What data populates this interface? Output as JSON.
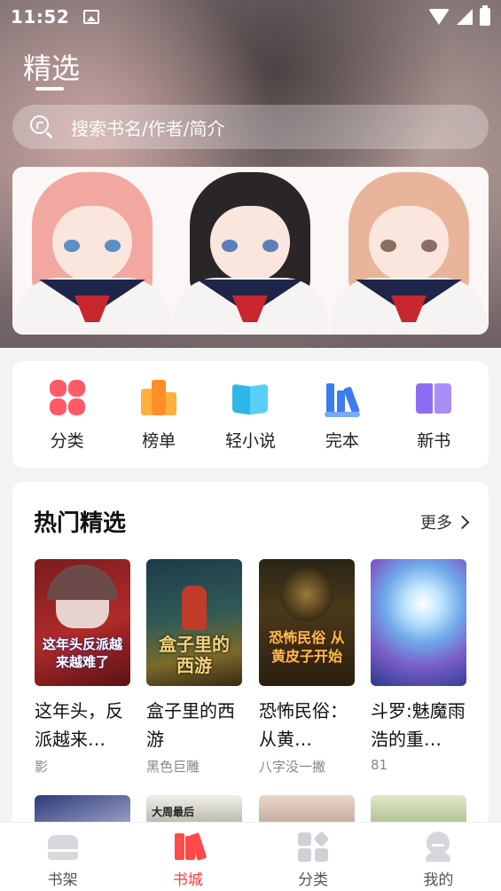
{
  "status_bar": {
    "time": "11:52"
  },
  "header": {
    "title": "精选"
  },
  "search": {
    "placeholder": "搜索书名/作者/简介"
  },
  "quick_nav": [
    {
      "label": "分类",
      "icon": "category-icon"
    },
    {
      "label": "榜单",
      "icon": "ranking-icon"
    },
    {
      "label": "轻小说",
      "icon": "light-novel-icon"
    },
    {
      "label": "完本",
      "icon": "completed-icon"
    },
    {
      "label": "新书",
      "icon": "new-book-icon"
    }
  ],
  "hot_picks": {
    "title": "热门精选",
    "more_label": "更多",
    "books": [
      {
        "title": "这年头，反派越来…",
        "author": "影",
        "cover_text": "这年头反派越来越难了"
      },
      {
        "title": "盒子里的西游",
        "author": "黑色巨雕",
        "cover_text": "盒子里的西游"
      },
      {
        "title": "恐怖民俗：从黄…",
        "author": "八字没一撇",
        "cover_text": "恐怖民俗 从黄皮子开始"
      },
      {
        "title": "斗罗:魅魔雨浩的重…",
        "author": "81",
        "cover_text": ""
      }
    ],
    "second_row_cover_text": "大周最后"
  },
  "bottom_nav": [
    {
      "label": "书架",
      "icon": "bookshelf-icon",
      "active": false
    },
    {
      "label": "书城",
      "icon": "bookstore-icon",
      "active": true
    },
    {
      "label": "分类",
      "icon": "category-grid-icon",
      "active": false
    },
    {
      "label": "我的",
      "icon": "profile-icon",
      "active": false
    }
  ],
  "colors": {
    "accent": "#ff3b3b",
    "card_bg": "#ffffff",
    "page_bg": "#f3f3f5"
  }
}
